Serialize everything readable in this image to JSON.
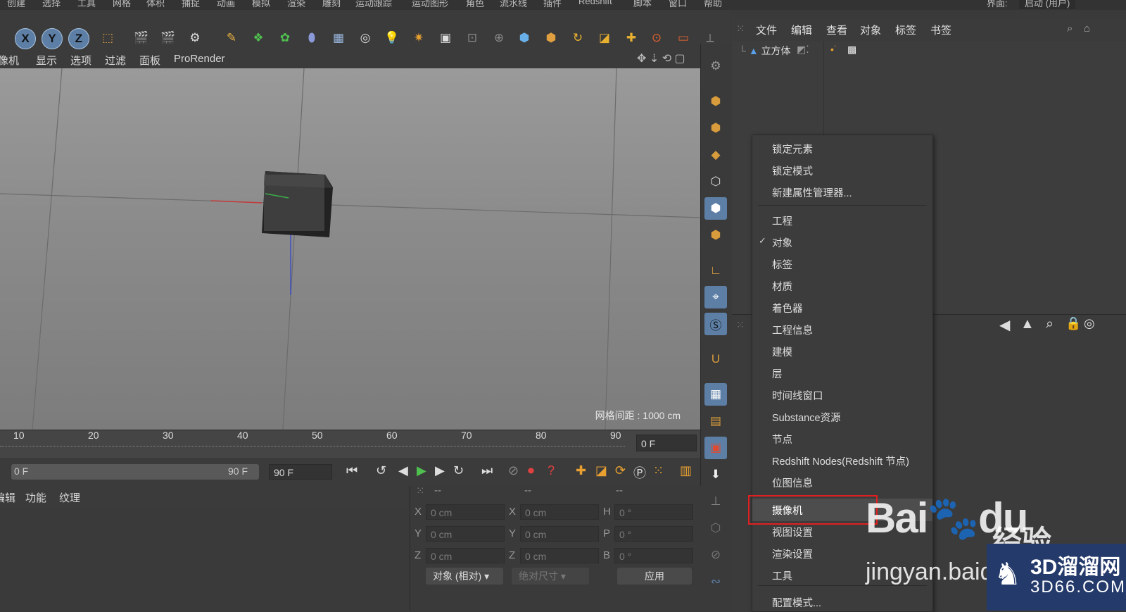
{
  "menubar": {
    "items": [
      "创建",
      "选择",
      "工具",
      "网格",
      "体积",
      "捕捉",
      "动画",
      "模拟",
      "渲染",
      "雕刻",
      "运动跟踪",
      "运动图形",
      "角色",
      "流水线",
      "插件",
      "Redshift",
      "脚本",
      "窗口",
      "帮助"
    ],
    "layout_label": "界面:",
    "layout_value": "启动 (用户)"
  },
  "toolbar": {
    "axis_x": "X",
    "axis_y": "Y",
    "axis_z": "Z"
  },
  "viewport_menu": {
    "items": [
      "摄像机",
      "显示",
      "选项",
      "过滤",
      "面板",
      "ProRender"
    ]
  },
  "viewport": {
    "grid_spacing": "网格间距 : 1000 cm"
  },
  "timeline": {
    "ticks": [
      "10",
      "20",
      "30",
      "40",
      "50",
      "60",
      "70",
      "80",
      "90"
    ],
    "current_frame": "0 F",
    "range_start": "0 F",
    "range_end": "90 F",
    "end_frame": "90 F"
  },
  "attributes_tabs": [
    "编辑",
    "功能",
    "纹理"
  ],
  "coordinates": {
    "header": [
      "--",
      "--",
      "--"
    ],
    "position": {
      "x": "0 cm",
      "y": "0 cm",
      "z": "0 cm"
    },
    "size": {
      "x": "0 cm",
      "y": "0 cm",
      "z": "0 cm"
    },
    "rotation": {
      "h": "0 °",
      "p": "0 °",
      "b": "0 °"
    },
    "labels": {
      "x": "X",
      "y": "Y",
      "z": "Z",
      "h": "H",
      "p": "P",
      "b": "B"
    },
    "mode_select": "对象 (相对)",
    "size_select": "绝对尺寸",
    "apply_button": "应用"
  },
  "object_manager": {
    "menu": [
      "文件",
      "编辑",
      "查看",
      "对象",
      "标签",
      "书签"
    ],
    "object_name": "立方体"
  },
  "context_menu": {
    "group1": [
      "锁定元素",
      "锁定模式",
      "新建属性管理器..."
    ],
    "group2": [
      "工程",
      "对象",
      "标签",
      "材质",
      "着色器",
      "工程信息",
      "建模",
      "层",
      "时间线窗口",
      "Substance资源",
      "节点",
      "Redshift Nodes(Redshift 节点)",
      "位图信息",
      "摄像机",
      "视图设置",
      "渲染设置",
      "工具"
    ],
    "group3": [
      "配置模式..."
    ],
    "checked_item": "对象",
    "highlighted_item": "摄像机"
  },
  "watermark": {
    "baidu": "Bai",
    "du": "du",
    "jingyan": "经验",
    "url": "jingyan.baidu.com",
    "brand_cn": "3D溜溜网",
    "brand_url": "3D66.COM"
  },
  "colors": {
    "accent": "#5d7fa6",
    "highlight_box": "#e02020",
    "brand_bg": "#243a6a"
  }
}
